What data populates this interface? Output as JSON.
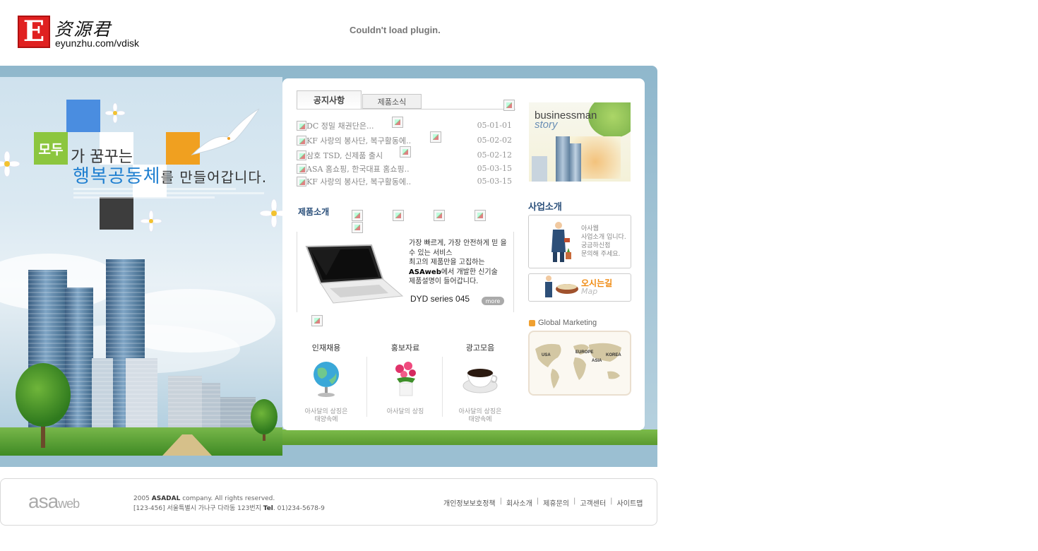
{
  "header": {
    "logo_letter": "E",
    "logo_cn": "资源君",
    "logo_url": "eyunzhu.com/vdisk",
    "plugin_message": "Couldn't load plugin."
  },
  "visual": {
    "modu": "모두",
    "line1": "가 꿈꾸는",
    "line2_main": "행복공동체",
    "line2_tail": "를 만들어갑니다."
  },
  "tabs": {
    "notice": "공지사항",
    "news": "제품소식"
  },
  "notices": [
    {
      "title": "DC 정밀 채권단은...",
      "date": "05-01-01"
    },
    {
      "title": "KF 사랑의 봉사단, 복구활동에..",
      "date": "05-02-02"
    },
    {
      "title": "삼호 TSD, 신제품 출시",
      "date": "05-02-12"
    },
    {
      "title": "ASA 홈쇼핑, 한국대표 홈쇼핑..",
      "date": "05-03-15"
    },
    {
      "title": "KF 사랑의 봉사단, 복구활동에..",
      "date": "05-03-15"
    }
  ],
  "product": {
    "title": "제품소개",
    "desc_l1": "가장 빠르게, 가장 안전하게 믿 을",
    "desc_l2": "수 있는 서비스",
    "desc_l3": "최고의 제품만을 고집하는",
    "desc_l4_b": "ASAweb",
    "desc_l4": "에서 개발한 신기술",
    "desc_l5": "제품설명이 들어갑니다.",
    "model": "DYD series 045",
    "more": "more"
  },
  "features": [
    {
      "title": "인재채용",
      "caption1": "아사달의 상징은",
      "caption2": "태양속에"
    },
    {
      "title": "홍보자료",
      "caption1": "아사달의 상징",
      "caption2": ""
    },
    {
      "title": "광고모음",
      "caption1": "아사달의 상징은",
      "caption2": "태양속에"
    }
  ],
  "right": {
    "story_t1": "businessman",
    "story_t2": "story",
    "biz_title": "사업소개",
    "biz_l1": "아사웹",
    "biz_l2": "사업소개 입니다.",
    "biz_l3": "궁금하신점",
    "biz_l4": "문의해 주세요.",
    "map_t1": "오시는길",
    "map_t2": "Map",
    "gm_title": "Global Marketing",
    "gm_usa": "USA",
    "gm_europe": "EUROPE",
    "gm_korea": "KOREA",
    "gm_asia": "ASIA"
  },
  "footer": {
    "logo_main": "asa",
    "logo_sub": "web",
    "copy_year": "2005 ",
    "copy_company": "ASADAL",
    "copy_rest": " company. All rights reserved.",
    "address": "[123-456] 서울특별시 가나구 다라동 123번지 ",
    "tel_label": "Tel",
    "tel": ". 01)234-5678-9",
    "links": [
      "개인정보보호정책",
      "회사소개",
      "제휴문의",
      "고객센터",
      "사이트맵"
    ],
    "sep": "|"
  },
  "colors": {
    "accent_blue": "#2a4f7a",
    "modu_green": "#8cc63f",
    "map_orange": "#f08a10",
    "logo_red": "#e02020"
  }
}
